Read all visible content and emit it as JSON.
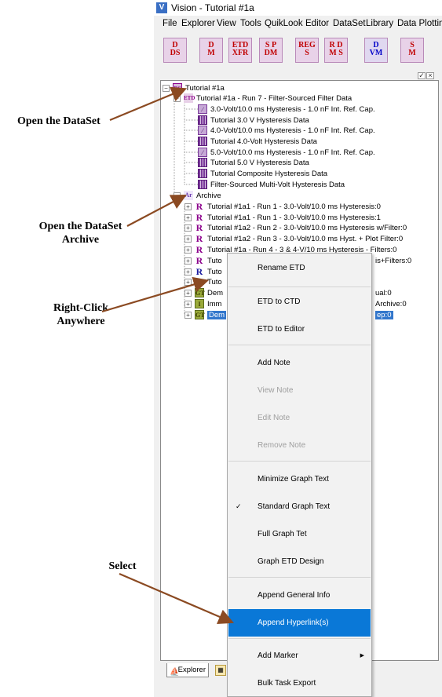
{
  "annotations": {
    "open_dataset": "Open the DataSet",
    "open_archive_1": "Open the DataSet",
    "open_archive_2": "Archive",
    "right_click_1": "Right-Click",
    "right_click_2": "Anywhere",
    "select": "Select"
  },
  "window": {
    "title": "Vision - Tutorial #1a",
    "app_icon": "V"
  },
  "menubar": [
    "File",
    "Explorer",
    "View",
    "Tools",
    "QuikLook",
    "Editor",
    "DataSet",
    "Library",
    "Data Plotting"
  ],
  "toolbar": [
    {
      "line1": "D",
      "line2": "DS",
      "icon": "dataset-icon"
    },
    {
      "line1": "D",
      "line2": "M",
      "icon": "data-manager-icon"
    },
    {
      "line1": "ETD",
      "line2": "XFR",
      "icon": "etd-transfer-icon"
    },
    {
      "line1": "S P",
      "line2": "DM",
      "icon": "spdm-icon"
    },
    {
      "line1": "REG",
      "line2": "S",
      "icon": "regs-icon"
    },
    {
      "line1": "R D",
      "line2": "M S",
      "icon": "rdms-icon"
    },
    {
      "line1": "D",
      "line2": "VM",
      "icon": "dvm-icon"
    },
    {
      "line1": "S",
      "line2": "M",
      "icon": "sm-icon"
    }
  ],
  "pane_buttons": [
    "✓",
    "×"
  ],
  "tree": {
    "root": "Tutorial #1a",
    "run7": "Tutorial #1a - Run 7 - Filter-Sourced Filter Data",
    "run7_children": [
      "3.0-Volt/10.0 ms Hysteresis - 1.0 nF Int. Ref. Cap.",
      "Tutorial 3.0 V Hysteresis Data",
      "4.0-Volt/10.0 ms Hysteresis - 1.0 nF Int. Ref. Cap.",
      "Tutorial 4.0-Volt Hysteresis Data",
      "5.0-Volt/10.0 ms Hysteresis - 1.0 nF Int. Ref. Cap.",
      "Tutorial 5.0 V Hysteresis Data",
      "Tutorial Composite Hysteresis Data",
      "Filter-Sourced Multi-Volt Hysteresis Data"
    ],
    "archive": "Archive",
    "archive_children": [
      "Tutorial #1a1 - Run 1 - 3.0-Volt/10.0 ms Hysteresis:0",
      "Tutorial #1a1 - Run 1 - 3.0-Volt/10.0 ms Hysteresis:1",
      "Tutorial #1a2 - Run 2 - 3.0-Volt/10.0 ms Hysteresis w/Filter:0",
      "Tutorial #1a2 - Run 3 - 3.0-Volt/10.0 ms Hyst. + Plot Filter:0",
      "Tutorial #1a - Run 4 - 3 & 4-V/10 ms Hysteresis - Filters:0",
      "Tuto",
      "Tuto",
      "Tuto",
      "Dem",
      "Imm",
      "Dem"
    ],
    "archive_suffixes": [
      "",
      "",
      "",
      "",
      "",
      "is+Filters:0",
      "",
      "",
      "ual:0",
      "Archive:0",
      "ep:0"
    ]
  },
  "context_menu": [
    {
      "label": "Rename ETD",
      "disabled": false
    },
    {
      "label": "ETD to CTD",
      "disabled": false
    },
    {
      "label": "ETD to Editor",
      "disabled": false
    },
    {
      "label": "Add Note",
      "disabled": false
    },
    {
      "label": "View Note",
      "disabled": true
    },
    {
      "label": "Edit Note",
      "disabled": true
    },
    {
      "label": "Remove Note",
      "disabled": true
    },
    {
      "label": "Minimize Graph Text",
      "disabled": false
    },
    {
      "label": "Standard Graph Text",
      "disabled": false,
      "checked": true
    },
    {
      "label": "Full Graph Tet",
      "disabled": false
    },
    {
      "label": "Graph ETD Design",
      "disabled": false
    },
    {
      "label": "Append General Info",
      "disabled": false
    },
    {
      "label": "Append Hyperlink(s)",
      "disabled": false,
      "highlighted": true
    },
    {
      "label": "Add Marker",
      "disabled": false,
      "submenu": true
    },
    {
      "label": "Bulk Task Export",
      "disabled": false
    }
  ],
  "check_glyph": "✓",
  "submenu_glyph": "▶",
  "status": {
    "explorer_tab": "Explorer"
  },
  "colors": {
    "highlight": "#0a78d7",
    "arrow": "#8b4a22",
    "selection": "#3377cc"
  }
}
